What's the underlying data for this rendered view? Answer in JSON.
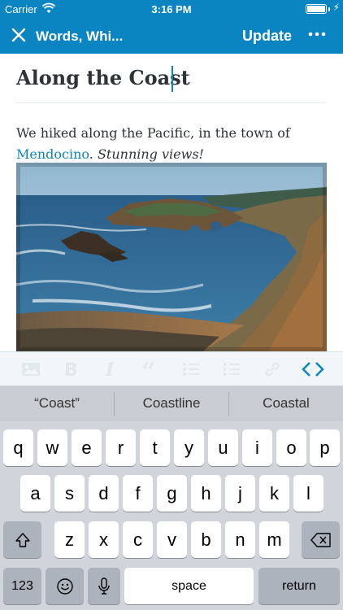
{
  "status_bar": {
    "carrier": "Carrier",
    "time": "3:16 PM",
    "wifi_icon": "wifi-icon",
    "battery_level": 1.0,
    "charging_icon": "bolt-icon"
  },
  "nav": {
    "close_icon": "close-icon",
    "title": "Words, Whi...",
    "update_label": "Update",
    "more_icon": "ellipsis-icon"
  },
  "post": {
    "title": "Along the Coast",
    "body_prefix": "We hiked along the Pacific, in the town of",
    "link_text": "Mendocino",
    "after_link": ".",
    "emphasis": "Stunning views!"
  },
  "toolbar": {
    "icons": [
      "image-icon",
      "bold-icon",
      "italic-icon",
      "blockquote-icon",
      "bullet-list-icon",
      "numbered-list-icon",
      "link-icon",
      "html-icon"
    ]
  },
  "suggestions": [
    "“Coast”",
    "Coastline",
    "Coastal"
  ],
  "keyboard": {
    "row1": [
      "q",
      "w",
      "e",
      "r",
      "t",
      "y",
      "u",
      "i",
      "o",
      "p"
    ],
    "row2": [
      "a",
      "s",
      "d",
      "f",
      "g",
      "h",
      "j",
      "k",
      "l"
    ],
    "row3": [
      "z",
      "x",
      "c",
      "v",
      "b",
      "n",
      "m"
    ],
    "numbers_label": "123",
    "space_label": "space",
    "return_label": "return"
  },
  "colors": {
    "brand_blue": "#0a85c2",
    "text_dark": "#2e3338"
  }
}
